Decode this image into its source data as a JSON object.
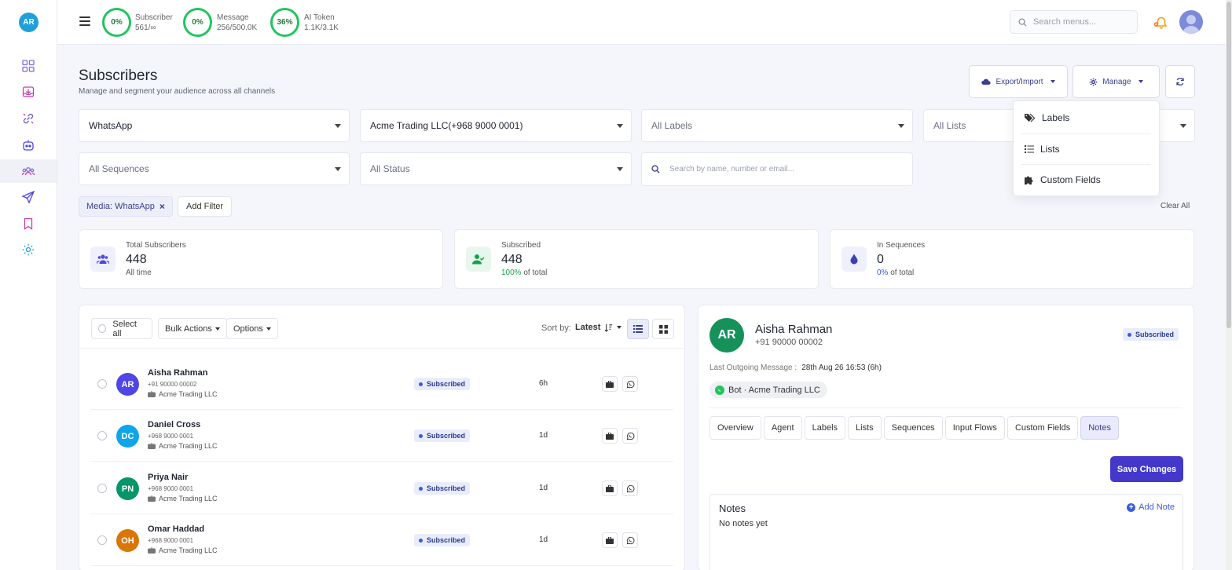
{
  "user": {
    "initials": "AR"
  },
  "topbar": {
    "stats": [
      {
        "percent": "0%",
        "label": "Subscriber",
        "value": "561/∞"
      },
      {
        "percent": "0%",
        "label": "Message",
        "value": "256/500.0K"
      },
      {
        "percent": "36%",
        "label": "AI Token",
        "value": "1.1K/3.1K"
      }
    ],
    "search_placeholder": "Search menus..."
  },
  "page": {
    "title": "Subscribers",
    "subtitle": "Manage and segment your audience across all channels"
  },
  "header_buttons": {
    "export_import": "Export/Import",
    "manage": "Manage"
  },
  "manage_menu": {
    "items": [
      "Labels",
      "Lists",
      "Custom Fields"
    ]
  },
  "filters": {
    "channel": "WhatsApp",
    "account": "Acme Trading LLC(+968 9000 0001)",
    "labels": "All Labels",
    "lists": "All Lists",
    "sequences": "All Sequences",
    "status": "All Status",
    "search_placeholder": "Search by name, number or email..."
  },
  "active_filters": {
    "chip": "Media: WhatsApp",
    "add_filter": "Add Filter",
    "clear_all": "Clear All"
  },
  "stats_cards": [
    {
      "label": "Total Subscribers",
      "value": "448",
      "sub": "All time"
    },
    {
      "label": "Subscribed",
      "value": "448",
      "sub_highlight": "100%",
      "sub": " of total"
    },
    {
      "label": "In Sequences",
      "value": "0",
      "sub_highlight": "0%",
      "sub": " of total"
    }
  ],
  "list_toolbar": {
    "select_all": "Select all",
    "bulk_actions": "Bulk Actions",
    "options": "Options",
    "sort_by": "Sort by:",
    "sort_value": "Latest"
  },
  "subscribers": [
    {
      "initials": "AR",
      "name": "Aisha Rahman",
      "phone": "+91 90000 00002",
      "company": "Acme Trading LLC",
      "status": "Subscribed",
      "time": "6h",
      "color": "#4f46e5"
    },
    {
      "initials": "DC",
      "name": "Daniel Cross",
      "phone": "+968 9000 0001",
      "company": "Acme Trading LLC",
      "status": "Subscribed",
      "time": "1d",
      "color": "#0ea5e9"
    },
    {
      "initials": "PN",
      "name": "Priya Nair",
      "phone": "+968 9000 0001",
      "company": "Acme Trading LLC",
      "status": "Subscribed",
      "time": "1d",
      "color": "#059669"
    },
    {
      "initials": "OH",
      "name": "Omar Haddad",
      "phone": "+968 9000 0001",
      "company": "Acme Trading LLC",
      "status": "Subscribed",
      "time": "1d",
      "color": "#d97706"
    }
  ],
  "detail": {
    "initials": "AR",
    "name": "Aisha Rahman",
    "phone": "+91 90000 00002",
    "status": "Subscribed",
    "last_msg_label": "Last Outgoing Message :",
    "last_msg_value": "28th Aug 26 16:53 (6h)",
    "bot_chip": "Bot · Acme Trading LLC",
    "tabs": [
      "Overview",
      "Agent",
      "Labels",
      "Lists",
      "Sequences",
      "Input Flows",
      "Custom Fields",
      "Notes"
    ],
    "save_label": "Save Changes",
    "notes_title": "Notes",
    "add_note": "Add Note",
    "notes_empty": "No notes yet"
  },
  "colors": {
    "accent": "#4338ca",
    "success": "#22c55e",
    "badge_bg": "#e9edfb"
  }
}
